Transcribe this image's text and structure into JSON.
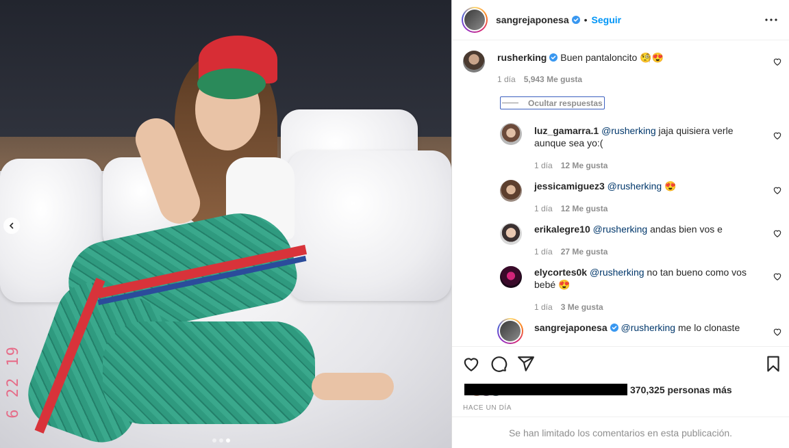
{
  "post": {
    "author": "sangrejaponesa",
    "follow_label": "Seguir",
    "separator": "•",
    "photo_stamp": "6 22 19"
  },
  "main_comment": {
    "username": "rusherking",
    "text": "Buen pantaloncito 🧐😍",
    "time": "1 día",
    "likes": "5,943 Me gusta"
  },
  "hide_replies_label": "Ocultar respuestas",
  "replies": [
    {
      "username": "luz_gamarra.1",
      "mention": "@rusherking",
      "text": " jaja quisiera verle aunque sea yo:(",
      "time": "1 día",
      "likes": "12 Me gusta"
    },
    {
      "username": "jessicamiguez3",
      "mention": "@rusherking",
      "text": " 😍",
      "time": "1 día",
      "likes": "12 Me gusta"
    },
    {
      "username": "erikalegre10",
      "mention": "@rusherking",
      "text": " andas bien vos e",
      "time": "1 día",
      "likes": "27 Me gusta"
    },
    {
      "username": "elycortes0k",
      "mention": "@rusherking",
      "text": " no tan bueno como vos bebé 😍",
      "time": "1 día",
      "likes": "3 Me gusta"
    },
    {
      "username": "sangrejaponesa",
      "mention": "@rusherking",
      "text": " me lo clonaste"
    }
  ],
  "likes_summary": "370,325 personas más",
  "timestamp": "HACE UN DÍA",
  "comments_limited": "Se han limitado los comentarios en esta publicación.",
  "colors": {
    "link": "#0095f6",
    "mention": "#00376b",
    "muted": "#8e8e8e",
    "text": "#262626",
    "verified": "#3897f0"
  },
  "icons": [
    "more-icon",
    "heart-icon",
    "comment-icon",
    "share-icon",
    "bookmark-icon",
    "verified-icon",
    "chevron-left-icon"
  ]
}
